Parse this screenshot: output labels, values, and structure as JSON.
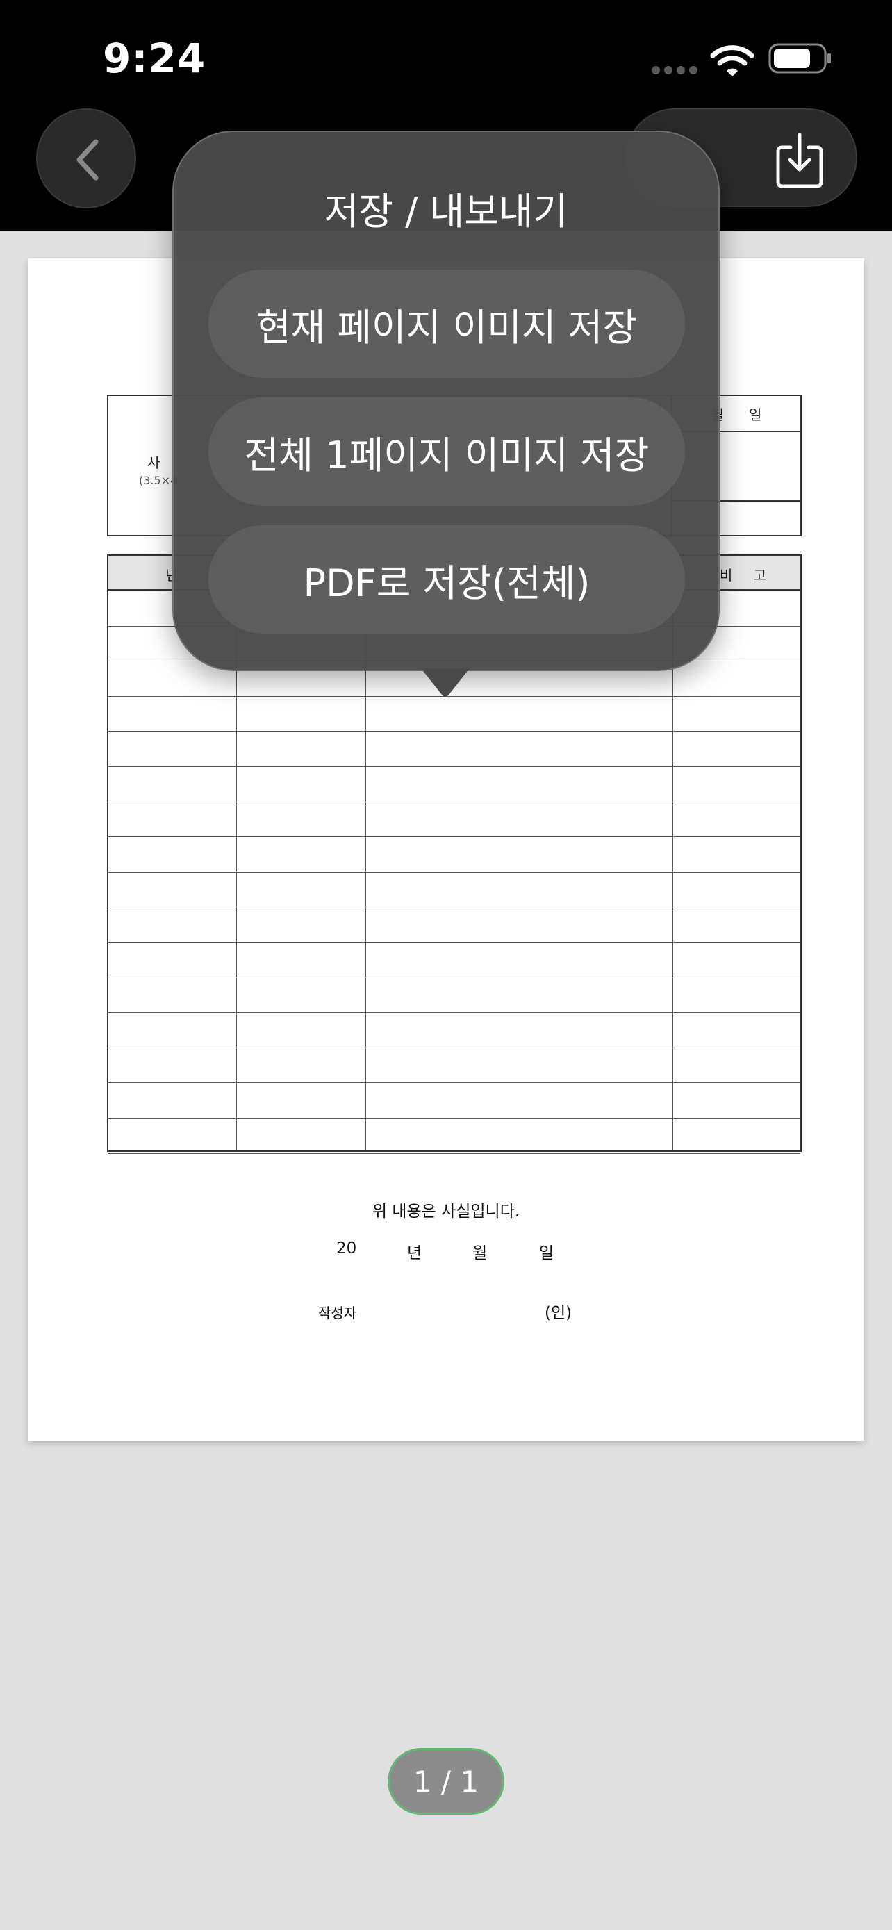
{
  "status_bar": {
    "time": "9:24"
  },
  "toolbar": {
    "back_icon": "chevron-left-icon",
    "download_icon": "download-icon"
  },
  "document": {
    "photo_label": "사",
    "photo_size": "(3.5×4",
    "date_header": [
      "월",
      "일"
    ],
    "table_head_left": "년",
    "table_head_right": "비 고",
    "statement": "위 내용은 사실입니다.",
    "date_line": {
      "year_prefix": "20",
      "year": "년",
      "month": "월",
      "day": "일"
    },
    "author_label": "작성자",
    "seal": "(인)"
  },
  "popup": {
    "title": "저장 / 내보내기",
    "options": [
      {
        "label": "현재 페이지 이미지 저장"
      },
      {
        "label": "전체 1페이지 이미지 저장"
      },
      {
        "label": "PDF로 저장(전체)"
      }
    ]
  },
  "pager": {
    "label": "1 / 1"
  },
  "colors": {
    "pager_border": "#63b872",
    "popup_bg": "#4a4a4a"
  }
}
